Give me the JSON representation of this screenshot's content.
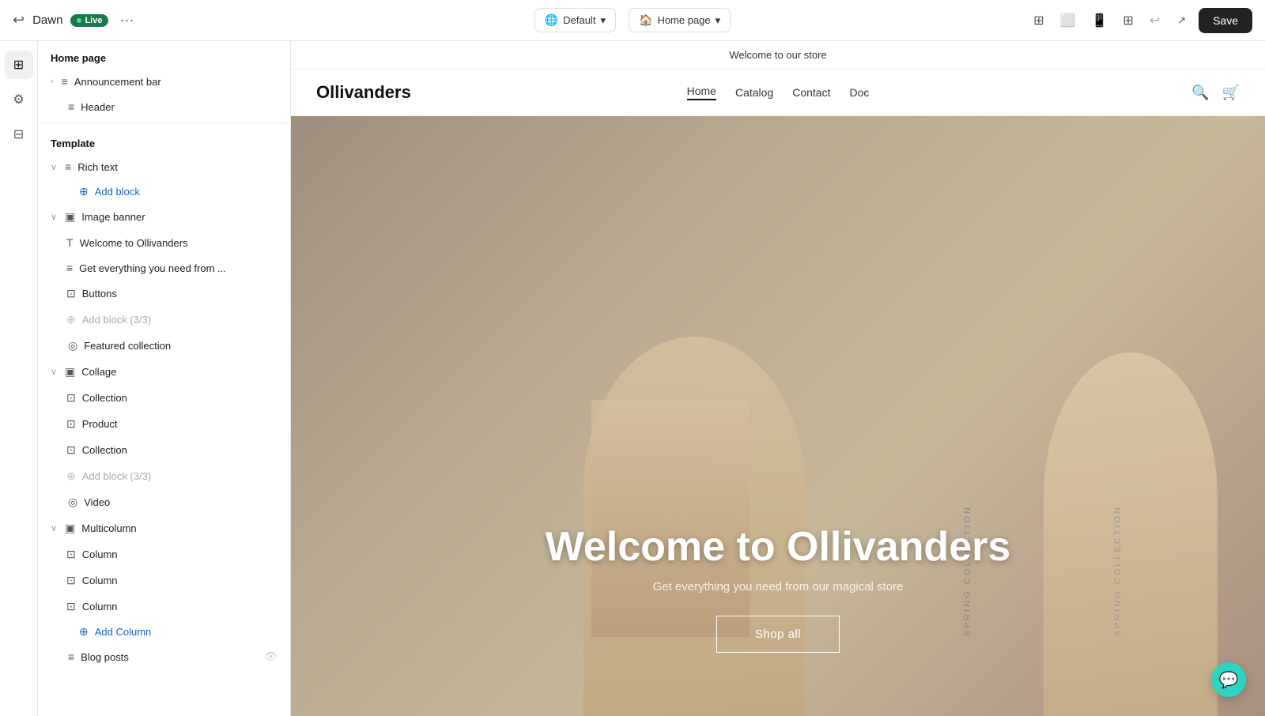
{
  "topbar": {
    "app_name": "Dawn",
    "live_label": "Live",
    "more_label": "···",
    "default_label": "Default",
    "page_label": "Home page",
    "save_label": "Save"
  },
  "sidebar": {
    "page_title": "Home page",
    "template_label": "Template",
    "items": [
      {
        "id": "announcement-bar",
        "label": "Announcement bar",
        "icon": "≡",
        "level": 1,
        "expandable": true
      },
      {
        "id": "header",
        "label": "Header",
        "icon": "≡",
        "level": 1
      },
      {
        "id": "rich-text",
        "label": "Rich text",
        "icon": "≡",
        "level": 1,
        "expandable": true,
        "expanded": true
      },
      {
        "id": "add-block-rich-text",
        "label": "Add block",
        "type": "add"
      },
      {
        "id": "image-banner",
        "label": "Image banner",
        "icon": "▣",
        "level": 1,
        "expandable": true,
        "expanded": true
      },
      {
        "id": "welcome-to-ollivanders",
        "label": "Welcome to Ollivanders",
        "icon": "T",
        "level": 2
      },
      {
        "id": "get-everything",
        "label": "Get everything you need from ...",
        "icon": "≡",
        "level": 2
      },
      {
        "id": "buttons",
        "label": "Buttons",
        "icon": "⊡",
        "level": 2
      },
      {
        "id": "add-block-image-banner",
        "label": "Add block (3/3)",
        "type": "add-disabled",
        "level": 2
      },
      {
        "id": "featured-collection",
        "label": "Featured collection",
        "icon": "◎",
        "level": 1
      },
      {
        "id": "collage",
        "label": "Collage",
        "icon": "▣",
        "level": 1,
        "expandable": true,
        "expanded": true
      },
      {
        "id": "collection-1",
        "label": "Collection",
        "icon": "⊡",
        "level": 2
      },
      {
        "id": "product",
        "label": "Product",
        "icon": "⊡",
        "level": 2
      },
      {
        "id": "collection-2",
        "label": "Collection",
        "icon": "⊡",
        "level": 2
      },
      {
        "id": "add-block-collage",
        "label": "Add block (3/3)",
        "type": "add-disabled",
        "level": 2
      },
      {
        "id": "video",
        "label": "Video",
        "icon": "◎",
        "level": 1
      },
      {
        "id": "multicolumn",
        "label": "Multicolumn",
        "icon": "▣",
        "level": 1,
        "expandable": true,
        "expanded": true
      },
      {
        "id": "column-1",
        "label": "Column",
        "icon": "⊡",
        "level": 2
      },
      {
        "id": "column-2",
        "label": "Column",
        "icon": "⊡",
        "level": 2
      },
      {
        "id": "column-3",
        "label": "Column",
        "icon": "⊡",
        "level": 2
      },
      {
        "id": "add-column",
        "label": "Add Column",
        "type": "add"
      },
      {
        "id": "blog-posts",
        "label": "Blog posts",
        "icon": "≡",
        "level": 1
      }
    ]
  },
  "preview": {
    "announcement": "Welcome to our store",
    "logo": "Ollivanders",
    "nav_links": [
      {
        "label": "Home",
        "active": true
      },
      {
        "label": "Catalog",
        "active": false
      },
      {
        "label": "Contact",
        "active": false
      },
      {
        "label": "Doc",
        "active": false
      }
    ],
    "hero": {
      "title": "Welcome to Ollivanders",
      "subtitle": "Get everything you need from our magical store",
      "cta_label": "Shop all",
      "spring_collection_left": "SPRING COLLECTION",
      "spring_collection_right": "SPRING COLLECTION"
    }
  }
}
